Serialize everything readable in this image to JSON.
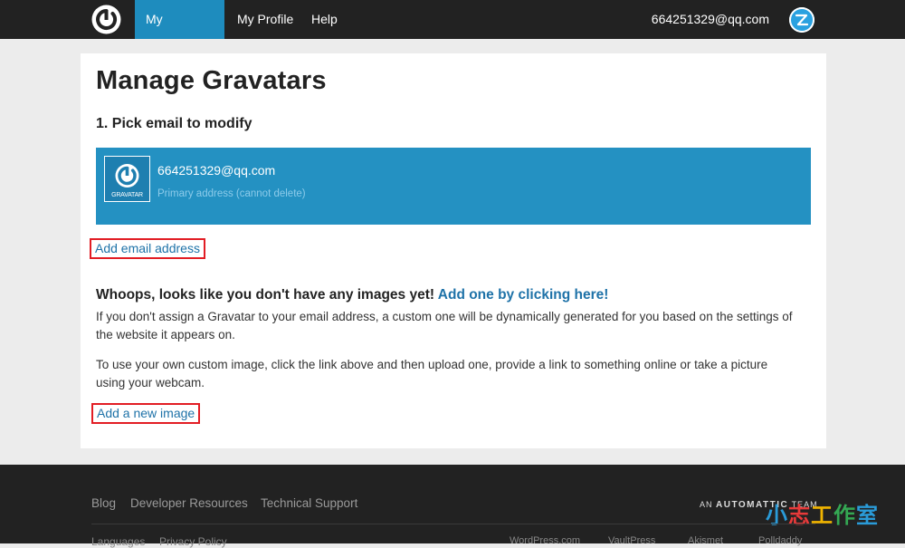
{
  "nav": {
    "logo_icon": "gravatar-logo-icon",
    "tabs": [
      {
        "label": "My Gravatars",
        "active": true
      },
      {
        "label": "My Profile",
        "active": false
      },
      {
        "label": "Help",
        "active": false
      }
    ],
    "user_email": "664251329@qq.com",
    "avatar_icon": "user-avatar-icon"
  },
  "main": {
    "title": "Manage Gravatars",
    "step1_title": "1. Pick email to modify",
    "email_row": {
      "avatar_caption": "GRAVATAR",
      "email": "664251329@qq.com",
      "note": "Primary address (cannot delete)"
    },
    "add_email_label": "Add email address",
    "whoops_text": "Whoops, looks like you don't have any images yet!",
    "whoops_link": "Add one by clicking here!",
    "paragraph1": "If you don't assign a Gravatar to your email address, a custom one will be dynamically generated for you based on the settings of the website it appears on.",
    "paragraph2": "To use your own custom image, click the link above and then upload one, provide a link to something online or take a picture using your webcam.",
    "add_image_label": "Add a new image"
  },
  "footer": {
    "links": [
      "Blog",
      "Developer Resources",
      "Technical Support"
    ],
    "links2": [
      "Languages",
      "Privacy Policy"
    ],
    "automattic_prefix": "AN",
    "automattic_name": "AUTOMATTIC",
    "automattic_suffix": "TEAM",
    "watermark": [
      {
        "char": "小",
        "color": "#2a9bd8"
      },
      {
        "char": "志",
        "color": "#e83a3a"
      },
      {
        "char": "工",
        "color": "#f0b400"
      },
      {
        "char": "作",
        "color": "#34a853"
      },
      {
        "char": "室",
        "color": "#2a9bd8"
      }
    ],
    "partners": [
      "WordPress.com",
      "VaultPress",
      "Akismet",
      "Polldaddy"
    ]
  },
  "colors": {
    "accent": "#1e8cbe",
    "email_row": "#2491c2",
    "link": "#1e72a8",
    "highlight_border": "#e21d24"
  }
}
